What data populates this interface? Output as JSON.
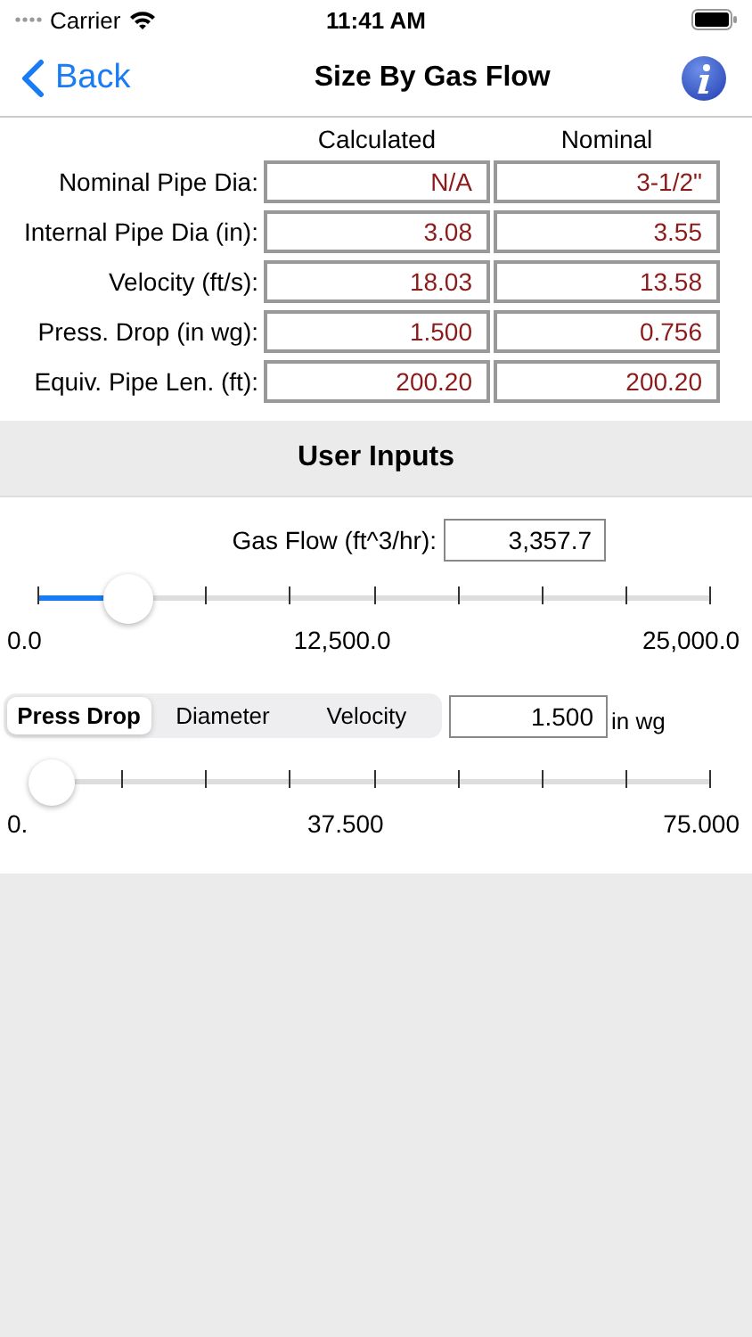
{
  "status_bar": {
    "carrier": "Carrier",
    "time": "11:41 AM"
  },
  "nav": {
    "back": "Back",
    "title": "Size By Gas Flow"
  },
  "results": {
    "columns": [
      "Calculated",
      "Nominal"
    ],
    "rows": [
      {
        "label": "Nominal Pipe Dia:",
        "calculated": "N/A",
        "nominal": "3-1/2\""
      },
      {
        "label": "Internal Pipe Dia (in):",
        "calculated": "3.08",
        "nominal": "3.55"
      },
      {
        "label": "Velocity (ft/s):",
        "calculated": "18.03",
        "nominal": "13.58"
      },
      {
        "label": "Press. Drop (in wg):",
        "calculated": "1.500",
        "nominal": "0.756"
      },
      {
        "label": "Equiv. Pipe Len. (ft):",
        "calculated": "200.20",
        "nominal": "200.20"
      }
    ]
  },
  "section_title": "User Inputs",
  "gas_flow": {
    "label": "Gas Flow (ft^3/hr):",
    "value": "3,357.7"
  },
  "gas_flow_slider": {
    "level": 0.134,
    "min": "0.0",
    "mid": "12,500.0",
    "max": "25,000.0"
  },
  "mode": {
    "segments": [
      {
        "label": "Press Drop",
        "selected": true
      },
      {
        "label": "Diameter",
        "selected": false
      },
      {
        "label": "Velocity",
        "selected": false
      }
    ],
    "value": "1.500",
    "unit": "in wg"
  },
  "mode_slider": {
    "level": 0.02,
    "min": "0.",
    "mid": "37.500",
    "max": "75.000"
  }
}
